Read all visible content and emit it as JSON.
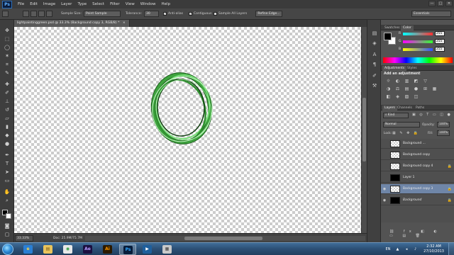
{
  "app": {
    "logo": "Ps",
    "menu": [
      "File",
      "Edit",
      "Image",
      "Layer",
      "Type",
      "Select",
      "Filter",
      "View",
      "Window",
      "Help"
    ],
    "window_controls": [
      "—",
      "□",
      "✕"
    ]
  },
  "options_bar": {
    "sample_size_label": "Sample Size:",
    "sample_size_value": "Point Sample",
    "tolerance_label": "Tolerance:",
    "tolerance_value": "30",
    "antialias_label": "Anti-alias",
    "contiguous_label": "Contiguous",
    "sample_all_label": "Sample All Layers",
    "refine_edge_label": "Refine Edge...",
    "workspace_value": "Essentials"
  },
  "document": {
    "tab_title": "lightpaintinggreen.psd @ 33.3% (Background copy 3, RGB/8) *",
    "tab_close": "×"
  },
  "status": {
    "zoom": "33.33%",
    "doc_size": "Doc: 25.9M/75.7M"
  },
  "color_panel": {
    "tabs": [
      "Swatches",
      "Color"
    ],
    "active_tab": "Color",
    "sliders": [
      {
        "label": "R",
        "value": "255",
        "color": "#ff3030"
      },
      {
        "label": "G",
        "value": "255",
        "color": "#30ff30"
      },
      {
        "label": "B",
        "value": "255",
        "color": "#3050ff"
      }
    ],
    "foreground": "#000000",
    "background": "#ffffff"
  },
  "adjustments_panel": {
    "tabs": [
      "Adjustments",
      "Styles"
    ],
    "active_tab": "Adjustments",
    "title": "Add an adjustment",
    "icon_rows": [
      [
        "☼",
        "◐",
        "▥",
        "◩",
        "▽"
      ],
      [
        "◑",
        "⚖",
        "▤",
        "●",
        "⊞",
        "▦"
      ],
      [
        "◧",
        "◈",
        "▨",
        "◫"
      ]
    ]
  },
  "layers_panel": {
    "tabs": [
      "Layers",
      "Channels",
      "Paths"
    ],
    "active_tab": "Layers",
    "kind_label": "Kind",
    "blend_mode": "Normal",
    "opacity_label": "Opacity:",
    "opacity_value": "100%",
    "lock_label": "Lock:",
    "fill_label": "Fill:",
    "fill_value": "100%",
    "layers": [
      {
        "name": "Background ...",
        "thumb": "checker",
        "visible": false,
        "selected": false,
        "italic": false,
        "locked": false
      },
      {
        "name": "Background copy",
        "thumb": "checker",
        "visible": false,
        "selected": false,
        "italic": false,
        "locked": false
      },
      {
        "name": "Background copy 4",
        "thumb": "checker",
        "visible": false,
        "selected": false,
        "italic": false,
        "locked": true
      },
      {
        "name": "Layer 1",
        "thumb": "black",
        "visible": false,
        "selected": false,
        "italic": false,
        "locked": false
      },
      {
        "name": "Background copy 3",
        "thumb": "checker",
        "visible": true,
        "selected": true,
        "italic": false,
        "locked": true
      },
      {
        "name": "Background",
        "thumb": "black",
        "visible": true,
        "selected": false,
        "italic": true,
        "locked": true
      }
    ]
  },
  "taskbar": {
    "apps": [
      {
        "name": "ie-icon",
        "label": "e",
        "bg": "#2a7fd4",
        "fg": "#ffd23f",
        "active": false
      },
      {
        "name": "explorer-icon",
        "label": "▤",
        "bg": "#e9c35c",
        "fg": "#7a5a12",
        "active": false
      },
      {
        "name": "chrome-icon",
        "label": "◉",
        "bg": "#e8e8e8",
        "fg": "#2f9a3f",
        "active": false
      },
      {
        "name": "after-effects-icon",
        "label": "Ae",
        "bg": "#1b1040",
        "fg": "#b79cff",
        "active": false
      },
      {
        "name": "illustrator-icon",
        "label": "Ai",
        "bg": "#2c1a00",
        "fg": "#ff9a00",
        "active": false
      },
      {
        "name": "photoshop-icon",
        "label": "Ps",
        "bg": "#071c3a",
        "fg": "#31a8ff",
        "active": true
      },
      {
        "name": "media-player-icon",
        "label": "▶",
        "bg": "#1f5f9c",
        "fg": "#ffffff",
        "active": false
      },
      {
        "name": "files-icon",
        "label": "▦",
        "bg": "#c9c9c9",
        "fg": "#3c3c3c",
        "active": false
      }
    ],
    "language": "EN",
    "time": "2:32 AM",
    "date": "27/10/2013"
  }
}
